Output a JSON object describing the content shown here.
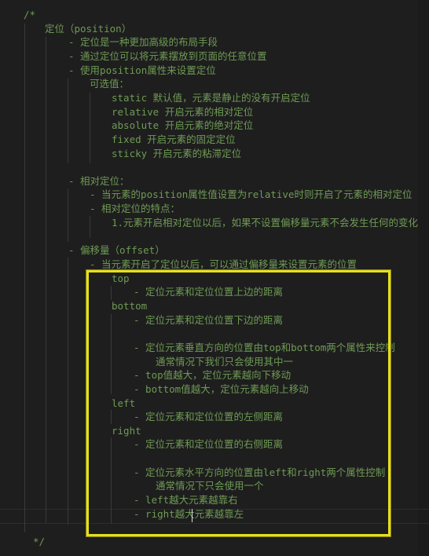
{
  "editor": {
    "lines": [
      "/*",
      "定位（position）",
      "- 定位是一种更加高级的布局手段",
      "- 通过定位可以将元素摆放到页面的任意位置",
      "- 使用position属性来设置定位",
      "可选值：",
      "static 默认值，元素是静止的没有开启定位",
      "relative 开启元素的相对定位",
      "absolute 开启元素的绝对定位",
      "fixed 开启元素的固定定位",
      "sticky 开启元素的粘滞定位",
      "- 相对定位：",
      "- 当元素的position属性值设置为relative时则开启了元素的相对定位",
      "- 相对定位的特点：",
      "1.元素开启相对定位以后，如果不设置偏移量元素不会发生任何的变化",
      "- 偏移量（offset）",
      "- 当元素开启了定位以后，可以通过偏移量来设置元素的位置",
      "top",
      "- 定位元素和定位位置上边的距离",
      "bottom",
      "- 定位元素和定位位置下边的距离",
      "- 定位元素垂直方向的位置由top和bottom两个属性来控制",
      "通常情况下我们只会使用其中一",
      "- top值越大，定位元素越向下移动",
      "- bottom值越大，定位元素越向上移动",
      "left",
      "- 定位元素和定位位置的左侧距离",
      "right",
      "- 定位元素和定位位置的右侧距离",
      "- 定位元素水平方向的位置由left和right两个属性控制",
      "通常情况下只会使用一个",
      "- left越大元素越靠右",
      "- right越大元素越靠左",
      "*/"
    ],
    "highlight_color": "#e6df1c"
  }
}
